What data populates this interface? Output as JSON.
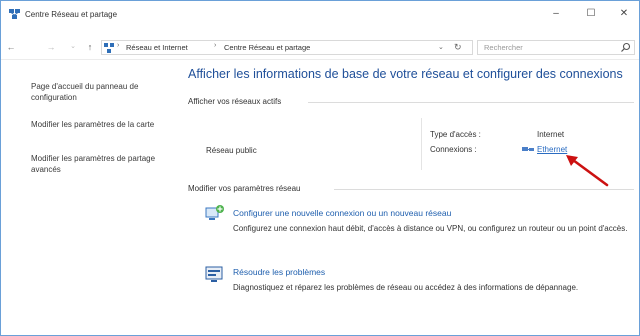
{
  "window": {
    "title": "Centre Réseau et partage",
    "controls": {
      "minimize": "–",
      "maximize": "☐",
      "close": "✕"
    }
  },
  "address_bar": {
    "breadcrumbs": [
      "Réseau et Internet",
      "Centre Réseau et partage"
    ],
    "search_placeholder": "Rechercher"
  },
  "sidebar": {
    "items": [
      {
        "label": "Page d'accueil du panneau de configuration"
      },
      {
        "label": "Modifier les paramètres de la carte"
      },
      {
        "label": "Modifier les paramètres de partage avancés"
      }
    ]
  },
  "main": {
    "title": "Afficher les informations de base de votre réseau et configurer des connexions",
    "active_networks_label": "Afficher vos réseaux actifs",
    "network": {
      "name": "Réseau public",
      "access_type_label": "Type d'accès :",
      "access_type_value": "Internet",
      "connections_label": "Connexions :",
      "connection_name": "Ethernet"
    },
    "modify_settings_label": "Modifier vos paramètres réseau",
    "tasks": [
      {
        "title": "Configurer une nouvelle connexion ou un nouveau réseau",
        "description": "Configurez une connexion haut débit, d'accès à distance ou VPN, ou configurez un routeur ou un point d'accès."
      },
      {
        "title": "Résoudre les problèmes",
        "description": "Diagnostiquez et réparez les problèmes de réseau ou accédez à des informations de dépannage."
      }
    ]
  },
  "colors": {
    "title_blue": "#1f4f99",
    "link_blue": "#2a6cc2",
    "annotation_red": "#cc1111"
  },
  "icons": [
    "network-center-icon",
    "back-arrow-icon",
    "forward-arrow-icon",
    "up-arrow-icon",
    "refresh-icon",
    "search-icon",
    "ethernet-icon",
    "new-connection-icon",
    "troubleshoot-icon",
    "red-arrow-annotation"
  ]
}
